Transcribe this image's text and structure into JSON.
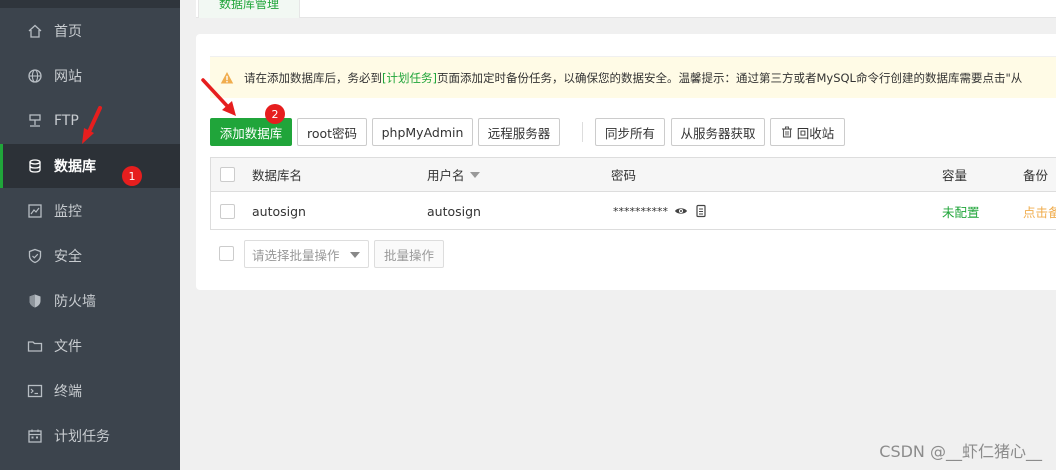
{
  "sidebar": {
    "items": [
      {
        "label": "首页",
        "icon": "home-icon"
      },
      {
        "label": "网站",
        "icon": "globe-icon"
      },
      {
        "label": "FTP",
        "icon": "ftp-icon"
      },
      {
        "label": "数据库",
        "icon": "database-icon",
        "active": true
      },
      {
        "label": "监控",
        "icon": "monitor-icon"
      },
      {
        "label": "安全",
        "icon": "shield-icon"
      },
      {
        "label": "防火墙",
        "icon": "firewall-icon"
      },
      {
        "label": "文件",
        "icon": "folder-icon"
      },
      {
        "label": "终端",
        "icon": "terminal-icon"
      },
      {
        "label": "计划任务",
        "icon": "calendar-icon"
      }
    ]
  },
  "tabs": {
    "active_label": "数据库管理"
  },
  "notice": {
    "before": "请在添加数据库后，务必到",
    "link": "[计划任务]",
    "after": "页面添加定时备份任务，以确保您的数据安全。温馨提示：通过第三方或者MySQL命令行创建的数据库需要点击\"从"
  },
  "toolbar": {
    "add_db": "添加数据库",
    "root_pwd": "root密码",
    "phpmyadmin": "phpMyAdmin",
    "remote": "远程服务器",
    "sync_all": "同步所有",
    "from_server": "从服务器获取",
    "recycle": "回收站"
  },
  "table": {
    "headers": {
      "name": "数据库名",
      "user": "用户名",
      "password": "密码",
      "capacity": "容量",
      "backup": "备份"
    },
    "rows": [
      {
        "name": "autosign",
        "user": "autosign",
        "password": "**********",
        "capacity": "未配置",
        "backup": "点击备"
      }
    ]
  },
  "batch": {
    "select_placeholder": "请选择批量操作",
    "button": "批量操作"
  },
  "annotations": {
    "badge1": "1",
    "badge2": "2"
  },
  "watermark": "CSDN @__虾仁猪心__",
  "colors": {
    "accent": "#20a53a",
    "sidebar": "#3c444d",
    "annotation": "#e61e1e"
  }
}
